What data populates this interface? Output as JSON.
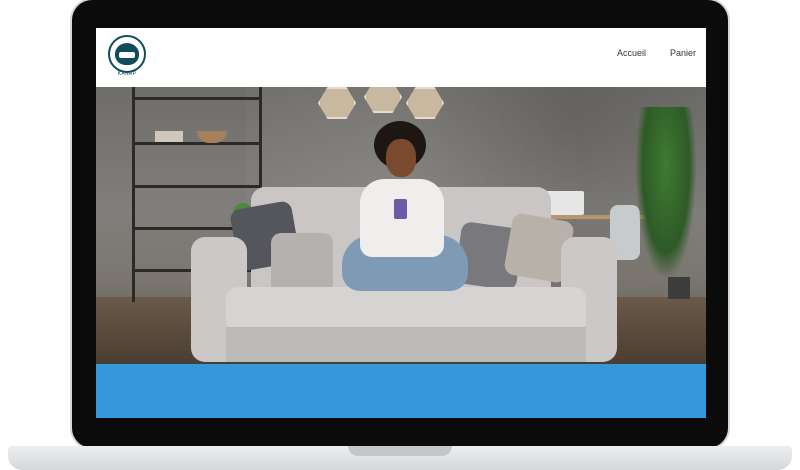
{
  "site": {
    "logo_text": "KANAP",
    "nav": [
      {
        "label": "Accueil"
      },
      {
        "label": "Panier"
      }
    ]
  },
  "hero": {
    "image_description": "woman on sofa with phone"
  },
  "colors": {
    "banner": "#3498db",
    "logo": "#0f4c5c",
    "frame": "#0b0b0c"
  }
}
